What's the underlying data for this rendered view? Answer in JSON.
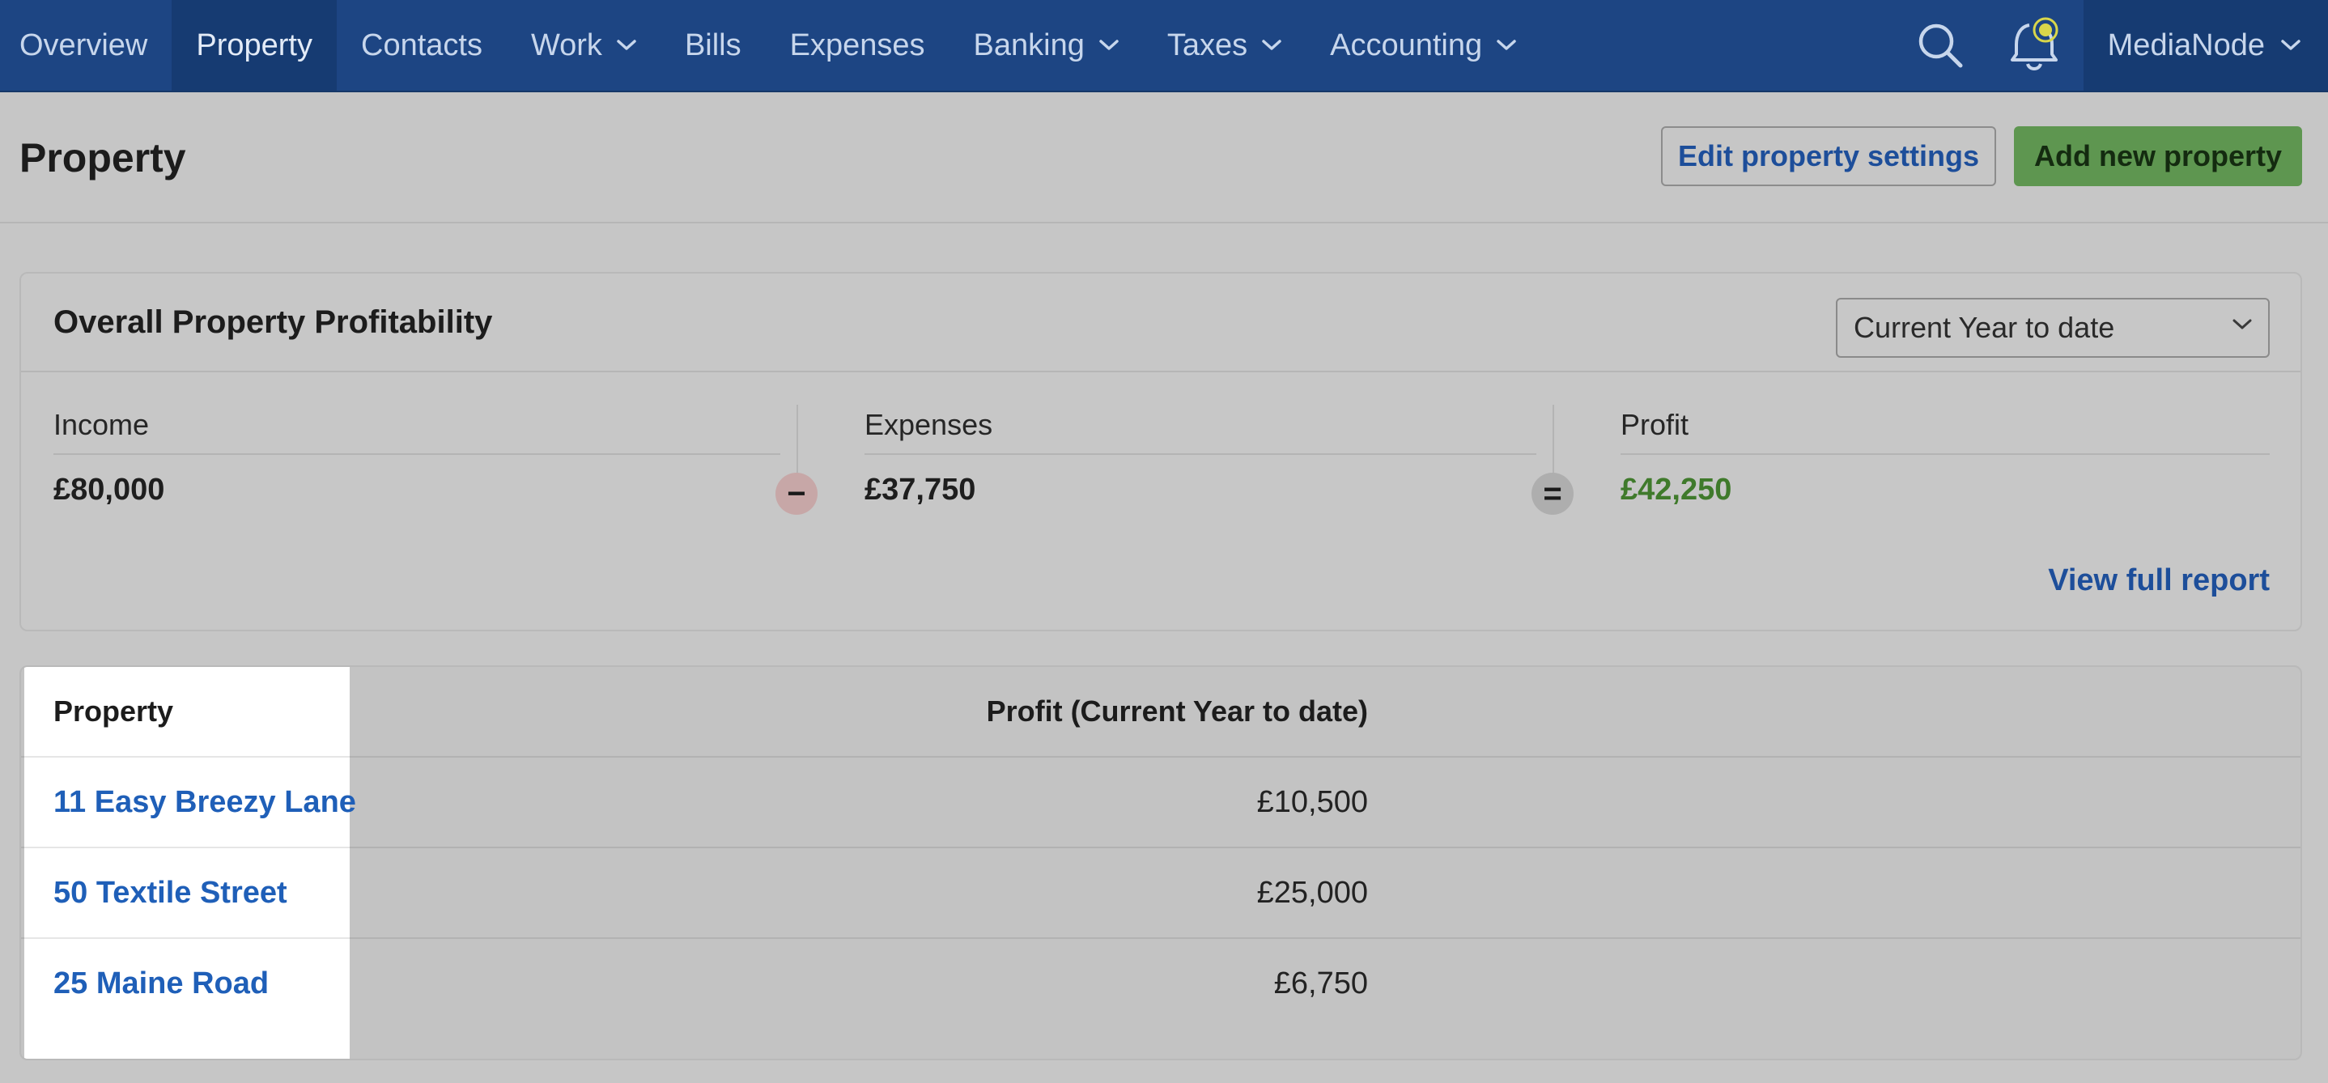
{
  "nav": {
    "items": [
      {
        "label": "Overview",
        "active": false,
        "dropdown": false
      },
      {
        "label": "Property",
        "active": true,
        "dropdown": false
      },
      {
        "label": "Contacts",
        "active": false,
        "dropdown": false
      },
      {
        "label": "Work",
        "active": false,
        "dropdown": true
      },
      {
        "label": "Bills",
        "active": false,
        "dropdown": false
      },
      {
        "label": "Expenses",
        "active": false,
        "dropdown": false
      },
      {
        "label": "Banking",
        "active": false,
        "dropdown": true
      },
      {
        "label": "Taxes",
        "active": false,
        "dropdown": true
      },
      {
        "label": "Accounting",
        "active": false,
        "dropdown": true
      }
    ],
    "account_name": "MediaNode",
    "icons": [
      "search-icon",
      "bell-icon",
      "chevron-down-icon"
    ]
  },
  "page": {
    "title": "Property",
    "edit_settings_label": "Edit property settings",
    "add_property_label": "Add new property"
  },
  "profitability": {
    "title": "Overall Property Profitability",
    "period": "Current Year to date",
    "income_label": "Income",
    "income_value": "£80,000",
    "expenses_label": "Expenses",
    "expenses_value": "£37,750",
    "profit_label": "Profit",
    "profit_value": "£42,250",
    "minus_symbol": "−",
    "equals_symbol": "=",
    "view_report_label": "View full report"
  },
  "table": {
    "headers": {
      "property": "Property",
      "profit": "Profit (Current Year to date)"
    },
    "rows": [
      {
        "name": "11 Easy Breezy Lane",
        "profit": "£10,500"
      },
      {
        "name": "50 Textile Street",
        "profit": "£25,000"
      },
      {
        "name": "25 Maine Road",
        "profit": "£6,750"
      }
    ]
  },
  "colors": {
    "nav_bg": "#1d4583",
    "nav_active_bg": "#163b72",
    "link_blue": "#1f5fb8",
    "primary_green": "#5e9650",
    "profit_green": "#3f7a2b",
    "notification_dot": "#d9d64a"
  }
}
